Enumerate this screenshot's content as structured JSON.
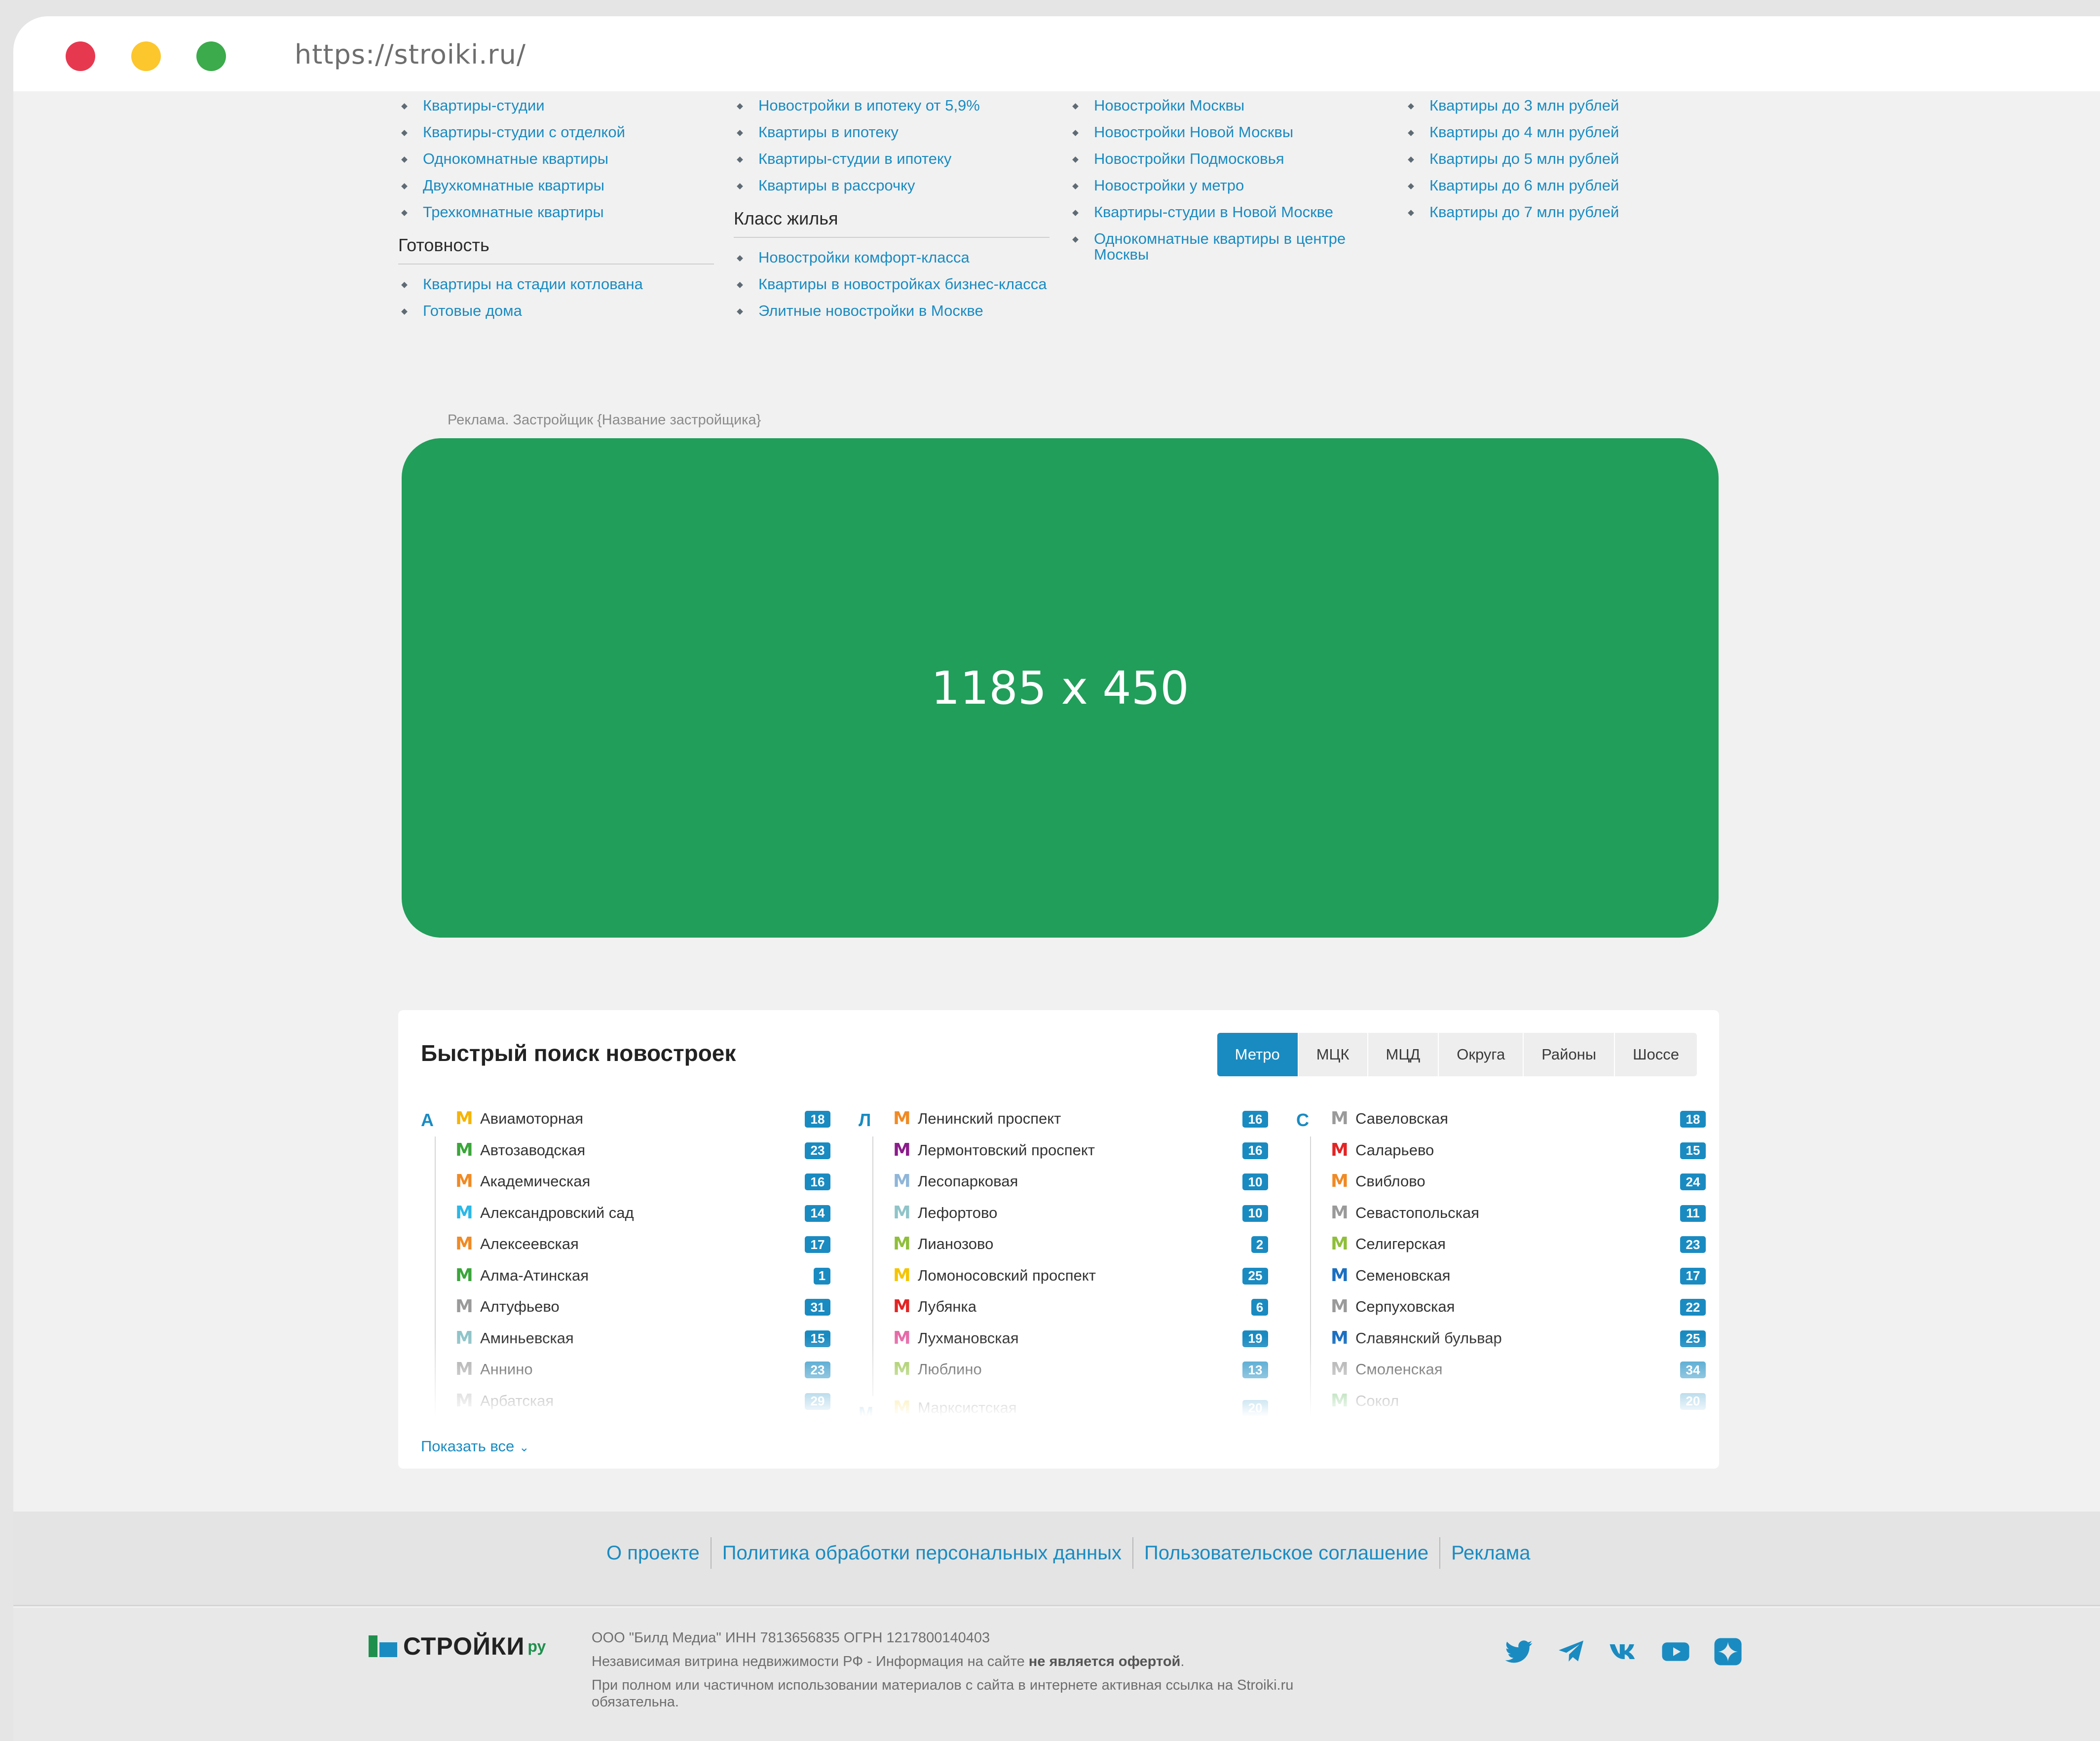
{
  "browser": {
    "url": "https://stroiki.ru/"
  },
  "categories": {
    "col1": {
      "items": [
        "Квартиры-студии",
        "Квартиры-студии с отделкой",
        "Однокомнатные квартиры",
        "Двухкомнатные квартиры",
        "Трехкомнатные квартиры"
      ],
      "heading2": "Готовность",
      "items2": [
        "Квартиры на стадии котлована",
        "Готовые дома"
      ]
    },
    "col2": {
      "items": [
        "Новостройки в ипотеку от 5,9%",
        "Квартиры в ипотеку",
        "Квартиры-студии в ипотеку",
        "Квартиры в рассрочку"
      ],
      "heading2": "Класс жилья",
      "items2": [
        "Новостройки комфорт-класса",
        "Квартиры в новостройках бизнес-класса",
        "Элитные новостройки в Москве"
      ]
    },
    "col3": {
      "items": [
        "Новостройки Москвы",
        "Новостройки Новой Москвы",
        "Новостройки Подмосковья",
        "Новостройки у метро",
        "Квартиры-студии в Новой Москве",
        "Однокомнатные квартиры в центре Москвы"
      ]
    },
    "col4": {
      "items": [
        "Квартиры до 3 млн рублей",
        "Квартиры до 4 млн рублей",
        "Квартиры до 5 млн рублей",
        "Квартиры до 6 млн рублей",
        "Квартиры до 7 млн рублей"
      ]
    }
  },
  "ad": {
    "label": "Реклама. Застройщик {Название застройщика}",
    "size_text": "1185 x 450",
    "color": "#219e5a"
  },
  "quick_search": {
    "title": "Быстрый поиск новостроек",
    "tabs": [
      "Метро",
      "МЦК",
      "МЦД",
      "Округа",
      "Районы",
      "Шоссе"
    ],
    "active_tab": "Метро",
    "metro_glyph": "M",
    "columns": [
      {
        "letter": "А",
        "stations": [
          {
            "name": "Авиамоторная",
            "count": "18",
            "line_color": "#f5b400"
          },
          {
            "name": "Автозаводская",
            "count": "23",
            "line_color": "#3aa63a"
          },
          {
            "name": "Академическая",
            "count": "16",
            "line_color": "#f08a24"
          },
          {
            "name": "Александровский сад",
            "count": "14",
            "line_color": "#2bb8e6"
          },
          {
            "name": "Алексеевская",
            "count": "17",
            "line_color": "#f08a24"
          },
          {
            "name": "Алма-Атинская",
            "count": "1",
            "line_color": "#3aa63a"
          },
          {
            "name": "Алтуфьево",
            "count": "31",
            "line_color": "#9a9a9a"
          },
          {
            "name": "Аминьевская",
            "count": "15",
            "line_color": "#8fc4c9"
          },
          {
            "name": "Аннино",
            "count": "23",
            "line_color": "#9a9a9a"
          },
          {
            "name": "Арбатская",
            "count": "29",
            "line_color": "#9a9a9a"
          }
        ]
      },
      {
        "letter": "Л",
        "letter2": "М",
        "stations": [
          {
            "name": "Ленинский проспект",
            "count": "16",
            "line_color": "#f08a24"
          },
          {
            "name": "Лермонтовский проспект",
            "count": "16",
            "line_color": "#8b1c8b"
          },
          {
            "name": "Лесопарковая",
            "count": "10",
            "line_color": "#8fb6d9"
          },
          {
            "name": "Лефортово",
            "count": "10",
            "line_color": "#8fc4c9"
          },
          {
            "name": "Лианозово",
            "count": "2",
            "line_color": "#8fbf3a"
          },
          {
            "name": "Ломоносовский проспект",
            "count": "25",
            "line_color": "#f5c400"
          },
          {
            "name": "Лубянка",
            "count": "6",
            "line_color": "#e32424"
          },
          {
            "name": "Лухмановская",
            "count": "19",
            "line_color": "#e66ba8"
          },
          {
            "name": "Люблино",
            "count": "13",
            "line_color": "#8fbf3a"
          },
          {
            "name": "Марксистская",
            "count": "20",
            "line_color": "#f5c400"
          }
        ]
      },
      {
        "letter": "С",
        "stations": [
          {
            "name": "Савеловская",
            "count": "18",
            "line_color": "#9a9a9a"
          },
          {
            "name": "Саларьево",
            "count": "15",
            "line_color": "#e32424"
          },
          {
            "name": "Свиблово",
            "count": "24",
            "line_color": "#f08a24"
          },
          {
            "name": "Севастопольская",
            "count": "11",
            "line_color": "#9a9a9a"
          },
          {
            "name": "Селигерская",
            "count": "23",
            "line_color": "#8fbf3a"
          },
          {
            "name": "Семеновская",
            "count": "17",
            "line_color": "#1a6fc1"
          },
          {
            "name": "Серпуховская",
            "count": "22",
            "line_color": "#9a9a9a"
          },
          {
            "name": "Славянский бульвар",
            "count": "25",
            "line_color": "#1a6fc1"
          },
          {
            "name": "Смоленская",
            "count": "34",
            "line_color": "#9a9a9a"
          },
          {
            "name": "Сокол",
            "count": "20",
            "line_color": "#3aa63a"
          }
        ]
      }
    ],
    "show_all": "Показать все"
  },
  "footer": {
    "links": [
      "О проекте",
      "Политика обработки персональных данных",
      "Пользовательское соглашение",
      "Реклама"
    ],
    "logo_text": "СТРОЙКИ",
    "logo_suffix": "ру",
    "legal": {
      "line1": "ООО \"Билд Медиа\" ИНН 7813656835 ОГРН 1217800140403",
      "line2_pre": "Независимая витрина недвижимости РФ - Информация на сайте ",
      "line2_bold": "не является офертой",
      "line2_post": ".",
      "line3": "При полном или частичном использовании материалов с сайта в интернете активная ссылка на Stroiki.ru обязательна."
    },
    "social": [
      "twitter-icon",
      "telegram-icon",
      "vk-icon",
      "youtube-icon",
      "zen-icon"
    ]
  }
}
